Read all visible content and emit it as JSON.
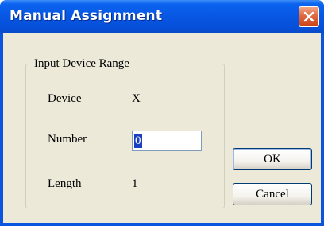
{
  "window": {
    "title": "Manual Assignment"
  },
  "group": {
    "label": "Input Device Range",
    "device_label": "Device",
    "device_value": "X",
    "number_label": "Number",
    "number_value": "0",
    "length_label": "Length",
    "length_value": "1"
  },
  "buttons": {
    "ok": "OK",
    "cancel": "Cancel"
  },
  "icons": {
    "close": "close-icon"
  },
  "colors": {
    "titlebar": "#0857e3",
    "close": "#e06840",
    "dialog_bg": "#ece9d8"
  }
}
